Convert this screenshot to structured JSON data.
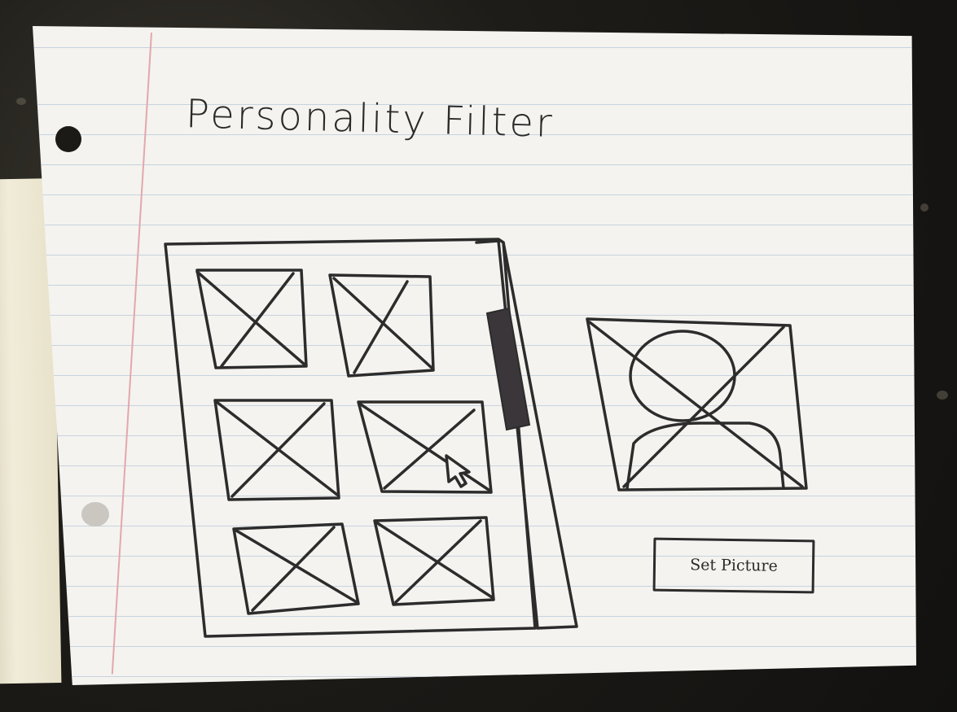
{
  "title": "Personality Filter",
  "set_picture_button": {
    "label": "Set Picture"
  },
  "grid": {
    "placeholder_count": 6
  },
  "colors": {
    "ink": "#2c2c2c",
    "paper": "#f4f3ef",
    "rule": "#c7d3df",
    "margin": "#e3a7ad"
  }
}
